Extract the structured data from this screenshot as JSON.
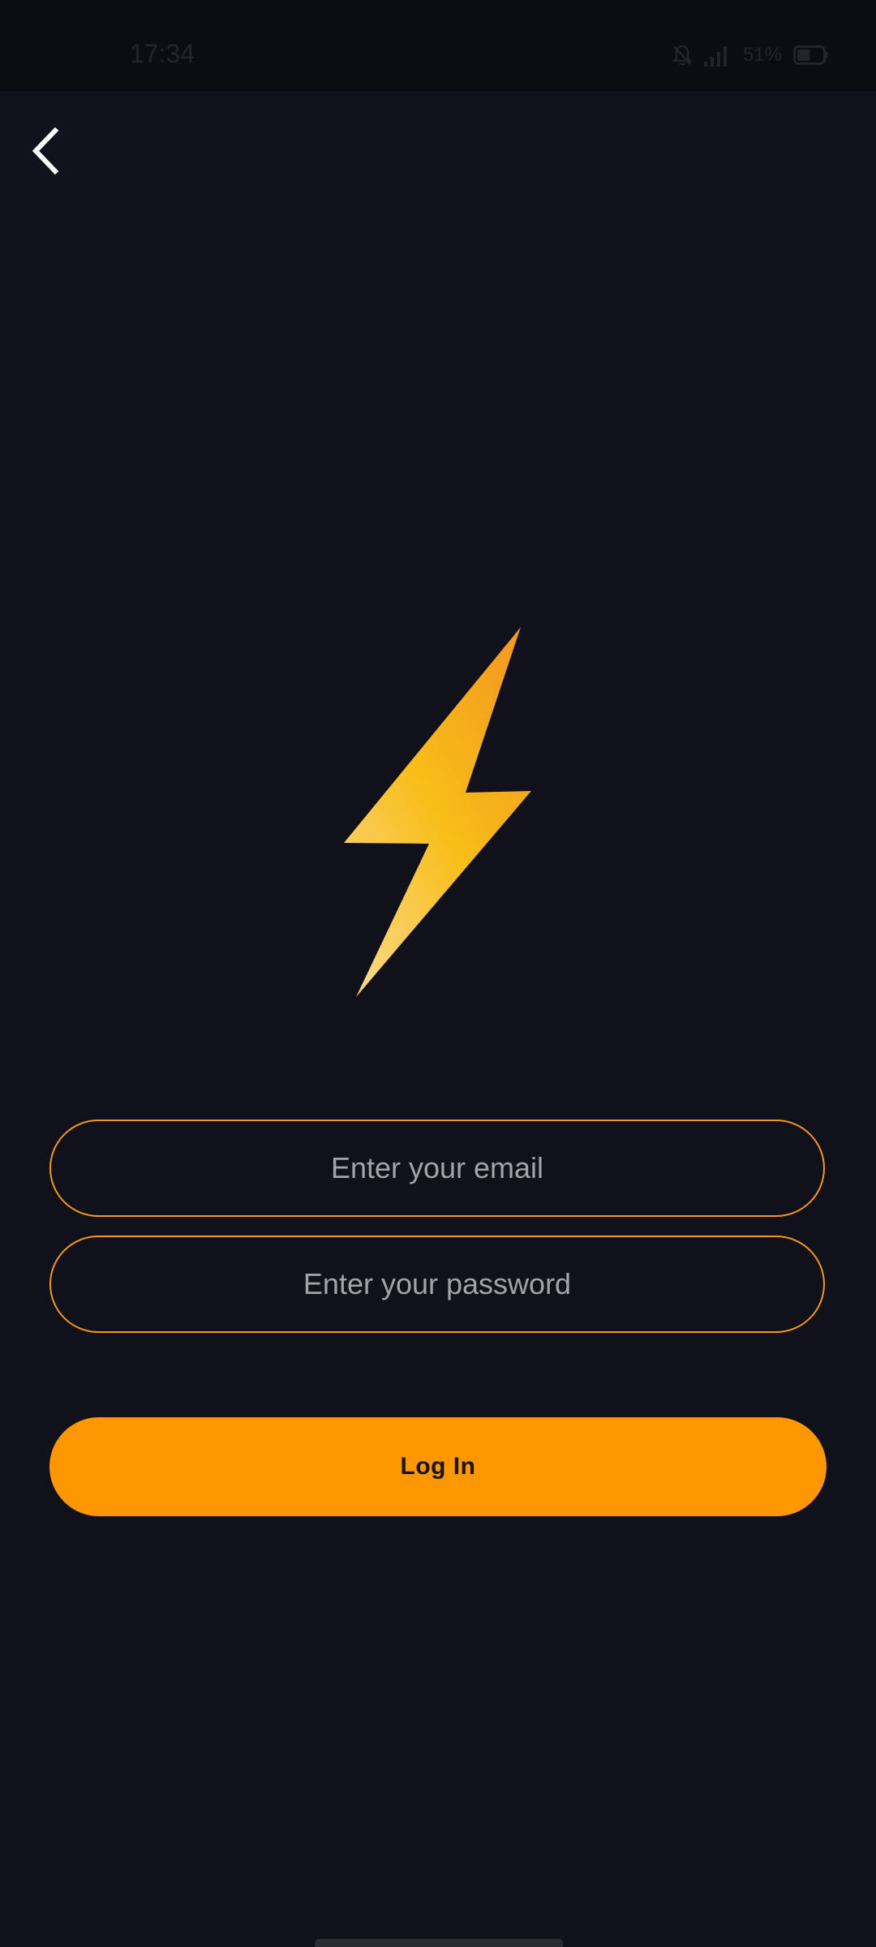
{
  "status_bar": {
    "time": "17:34",
    "battery_percent": "51%",
    "battery_level": 0.51,
    "icons": [
      "bell-off-icon",
      "signal-icon",
      "battery-icon"
    ]
  },
  "header": {
    "back_icon": "chevron-left-icon"
  },
  "logo": {
    "icon": "lightning-bolt-icon",
    "colors": [
      "#f39a1f",
      "#f8bd18",
      "#fbd783"
    ]
  },
  "form": {
    "email_placeholder": "Enter your email",
    "email_value": "",
    "password_placeholder": "Enter your password",
    "password_value": "",
    "login_label": "Log In"
  },
  "colors": {
    "background": "#10111a",
    "accent": "#fe9701",
    "field_border": "#f5961e"
  }
}
